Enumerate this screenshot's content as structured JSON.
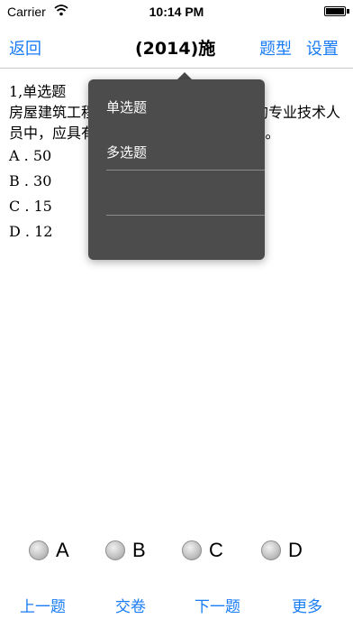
{
  "status_bar": {
    "carrier": "Carrier",
    "time": "10:14 PM",
    "battery_level": 1.0
  },
  "nav": {
    "back": "返回",
    "title": "(2014)施",
    "question_type": "题型",
    "settings": "设置"
  },
  "question": {
    "header": "1,单选题",
    "text": "房屋建筑工程施工总承包一级企业法定的专业技术人员中，应具有一级资质项目经理()人以上。",
    "options": [
      "A . 50",
      "B . 30",
      "C . 15",
      "D . 12"
    ]
  },
  "popup": {
    "items": [
      "单选题",
      "多选题"
    ]
  },
  "choices": [
    "A",
    "B",
    "C",
    "D"
  ],
  "toolbar": {
    "prev": "上一题",
    "submit": "交卷",
    "next": "下一题",
    "more": "更多"
  },
  "colors": {
    "accent": "#1a7cf5",
    "popup_bg": "#4c4c4c"
  },
  "icons": {
    "wifi": "wifi-icon",
    "battery": "battery-icon"
  }
}
